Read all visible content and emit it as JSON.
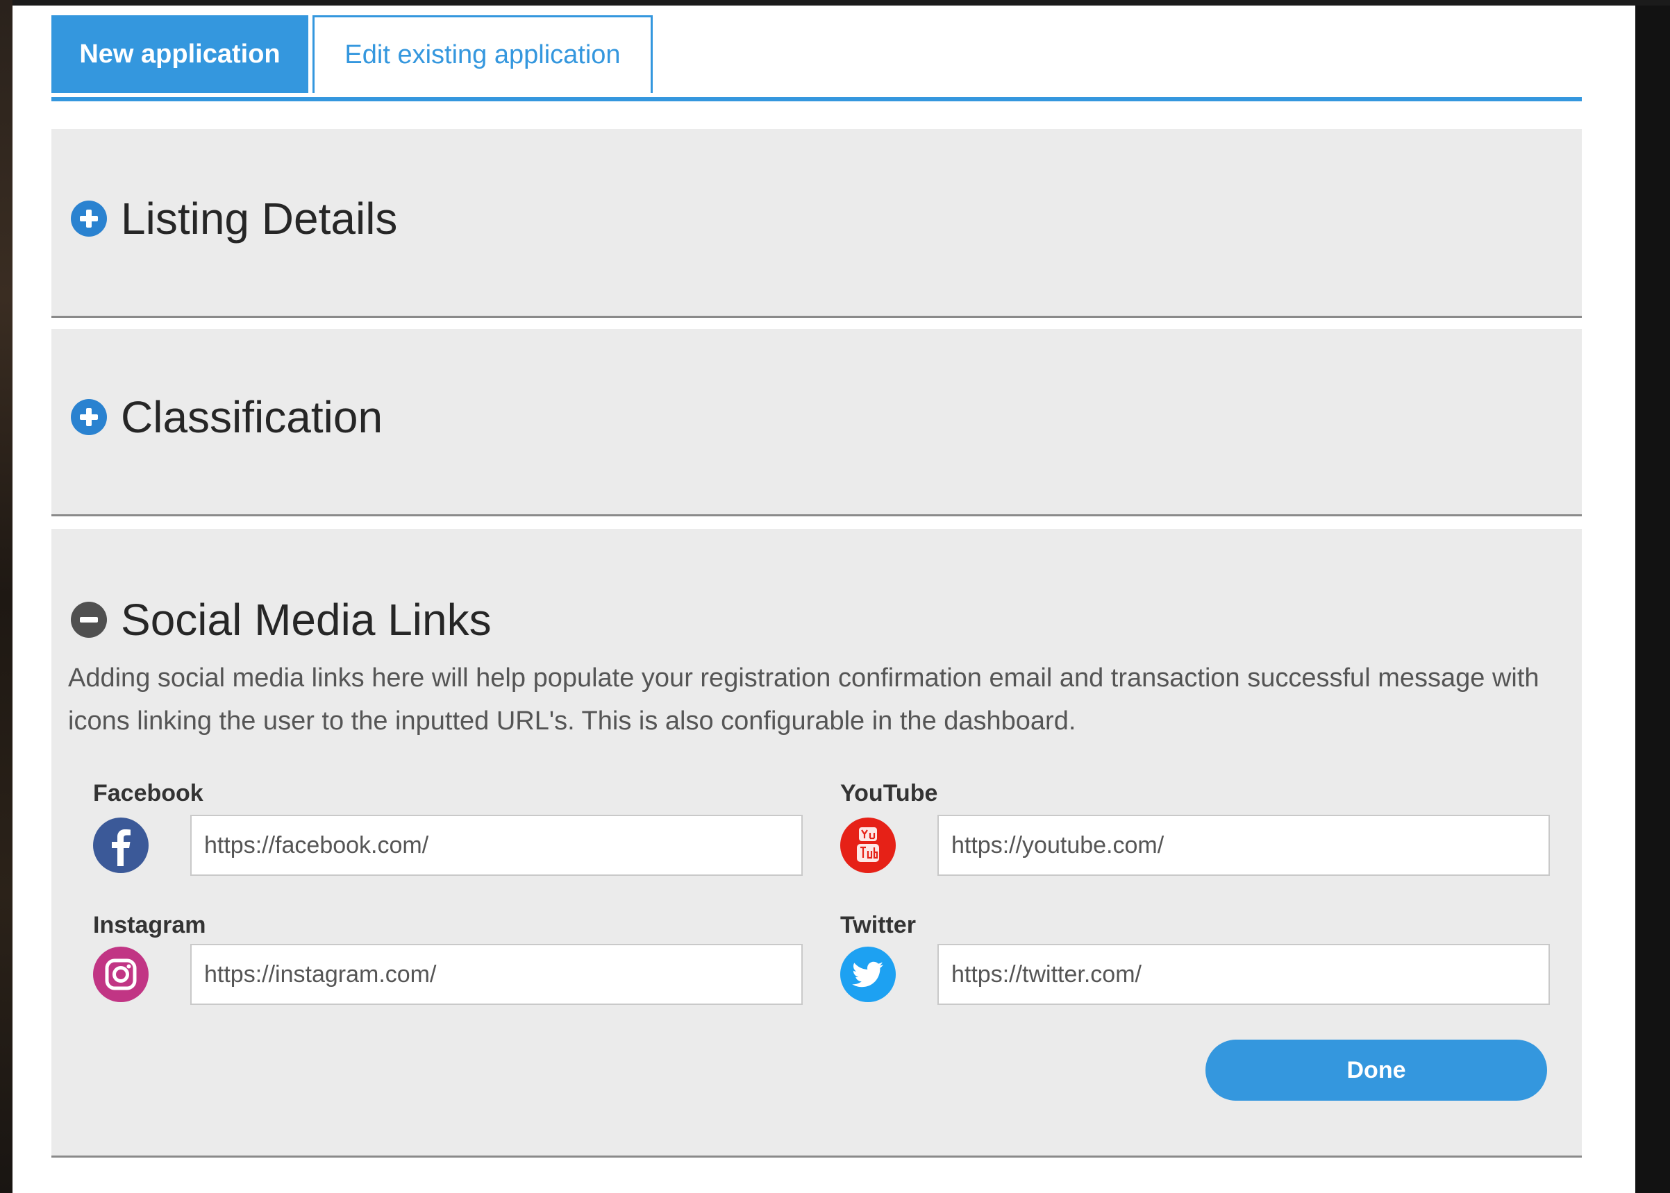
{
  "tabs": {
    "new_application": "New application",
    "edit_existing_application": "Edit existing application"
  },
  "sections": {
    "listing_details": {
      "title": "Listing Details",
      "state": "collapsed",
      "icon": "plus-circle-icon"
    },
    "classification": {
      "title": "Classification",
      "state": "collapsed",
      "icon": "plus-circle-icon"
    },
    "social_media_links": {
      "title": "Social Media Links",
      "state": "expanded",
      "icon": "minus-circle-icon",
      "description": "Adding social media links here will help populate your registration confirmation email and transaction successful message with icons linking the user to the inputted URL's. This is also configurable in the dashboard.",
      "fields": {
        "facebook": {
          "label": "Facebook",
          "value": "https://facebook.com/",
          "icon": "facebook-icon"
        },
        "youtube": {
          "label": "YouTube",
          "value": "https://youtube.com/",
          "icon": "youtube-icon"
        },
        "instagram": {
          "label": "Instagram",
          "value": "https://instagram.com/",
          "icon": "instagram-icon"
        },
        "twitter": {
          "label": "Twitter",
          "value": "https://twitter.com/",
          "icon": "twitter-icon"
        }
      },
      "done_label": "Done"
    }
  },
  "colors": {
    "accent": "#3497de",
    "section_background": "#ebebeb",
    "facebook": "#3b5998",
    "youtube": "#e62117",
    "instagram": "#c13584",
    "twitter": "#1da1f2"
  }
}
